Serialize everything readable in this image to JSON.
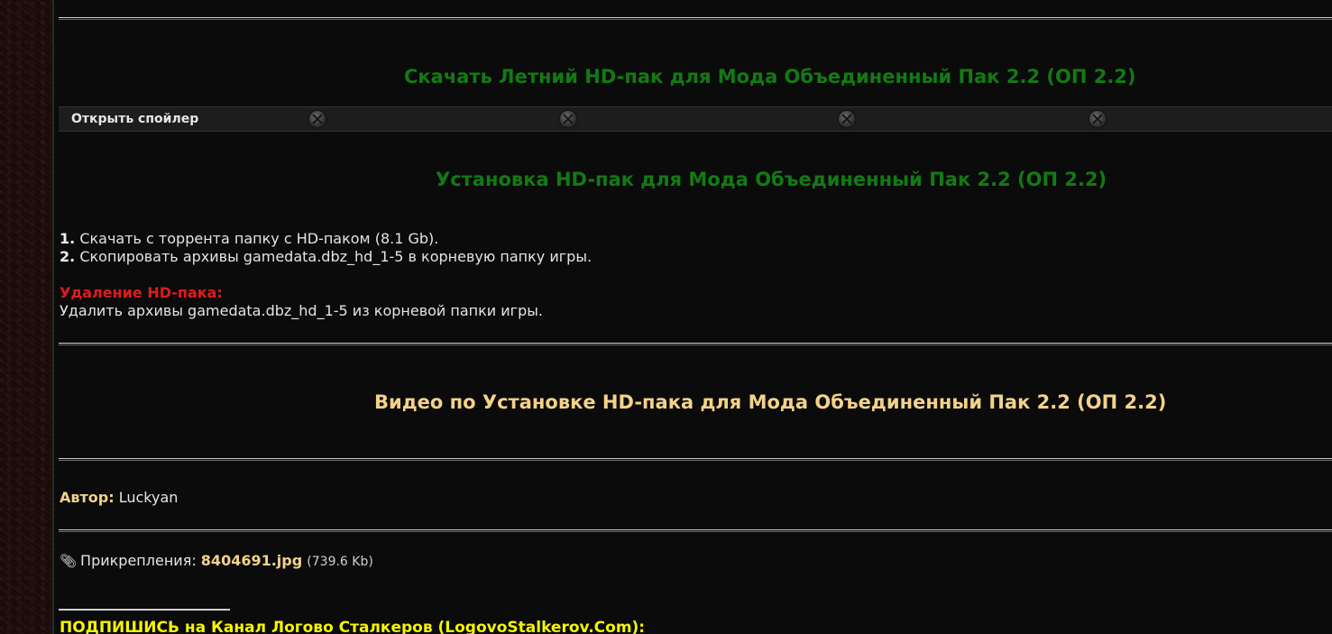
{
  "sections": {
    "download_heading": "Скачать Летний HD-пак для Мода Объединенный Пак 2.2 (ОП 2.2)",
    "spoiler_label": "Открыть спойлер",
    "install_heading": "Установка HD-пак для Мода Объединенный Пак 2.2 (ОП 2.2)",
    "steps": [
      {
        "num": "1.",
        "text": "Скачать с торрента папку с HD-паком (8.1 Gb)."
      },
      {
        "num": "2.",
        "text": "Скопировать архивы gamedata.dbz_hd_1-5 в корневую папку игры."
      }
    ],
    "removal_title": "Удаление HD-пака:",
    "removal_text": "Удалить архивы gamedata.dbz_hd_1-5 из корневой папки игры.",
    "video_heading": "Видео по Установке HD-пака для Мода Объединенный Пак 2.2 (ОП 2.2)",
    "author_label": "Автор:",
    "author_name": "Luckyan",
    "attachments_label": "Прикрепления:",
    "attachment_file": "8404691.jpg",
    "attachment_size": "(739.6 Kb)",
    "subscribe_text": "ПОДПИШИСЬ на Канал Логово Сталкеров (LogovoStalkerov.Com):"
  },
  "colors": {
    "green_heading": "#137a13",
    "gold_heading": "#f3d28a",
    "red_title": "#e01b1b",
    "yellow_link": "#f5f500"
  },
  "icons": [
    "close-icon",
    "paperclip-icon"
  ]
}
